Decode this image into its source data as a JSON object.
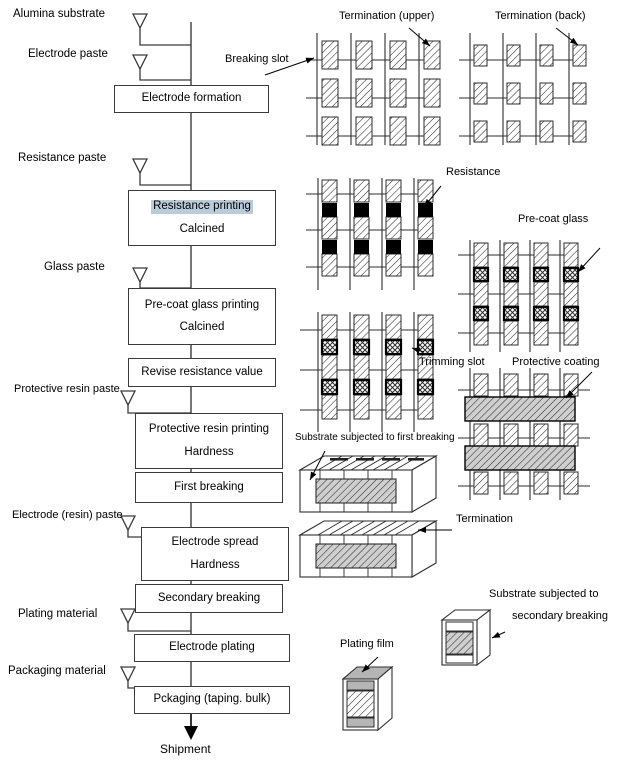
{
  "diagram": {
    "title": "Chip resistor manufacturing process flow",
    "colors": {
      "line": "#3a3a3a",
      "slot": "#6f6f6f",
      "highlight": "#b9ccd9",
      "resistance_fill": "#000000",
      "coating_fill": "#c9c9c9",
      "plating_fill": "#b5b5b5",
      "text": "#000000"
    }
  },
  "flow": {
    "inputs": [
      {
        "label": "Alumina substrate",
        "marker": "inverted-triangle-icon"
      },
      {
        "label": "Electrode paste",
        "marker": "inverted-triangle-icon"
      },
      {
        "label": "Resistance paste",
        "marker": "inverted-triangle-icon"
      },
      {
        "label": "Glass paste",
        "marker": "inverted-triangle-icon"
      },
      {
        "label": "Protective resin paste",
        "marker": "inverted-triangle-icon"
      },
      {
        "label": "Electrode (resin) paste",
        "marker": "inverted-triangle-icon"
      },
      {
        "label": "Plating material",
        "marker": "inverted-triangle-icon"
      },
      {
        "label": "Packaging material",
        "marker": "inverted-triangle-icon"
      }
    ],
    "steps": [
      {
        "line1": "Electrode formation",
        "line2": "",
        "highlight": false
      },
      {
        "line1": "Resistance printing",
        "line2": "Calcined",
        "highlight": true
      },
      {
        "line1": "Pre-coat glass printing",
        "line2": "Calcined",
        "highlight": false
      },
      {
        "line1": "Revise resistance value",
        "line2": "",
        "highlight": false
      },
      {
        "line1": "Protective resin printing",
        "line2": "Hardness",
        "highlight": false
      },
      {
        "line1": "First breaking",
        "line2": "",
        "highlight": false
      },
      {
        "line1": "Electrode spread",
        "line2": "Hardness",
        "highlight": false
      },
      {
        "line1": "Secondary breaking",
        "line2": "",
        "highlight": false
      },
      {
        "line1": "Electrode plating",
        "line2": "",
        "highlight": false
      },
      {
        "line1": "Pckaging (taping. bulk)",
        "line2": "",
        "highlight": false
      }
    ],
    "output": "Shipment"
  },
  "illustrations": {
    "callouts": [
      {
        "id": "breaking-slot",
        "text": "Breaking slot"
      },
      {
        "id": "termination-upper",
        "text": "Termination (upper)"
      },
      {
        "id": "termination-back",
        "text": "Termination (back)"
      },
      {
        "id": "resistance",
        "text": "Resistance"
      },
      {
        "id": "pre-coat-glass",
        "text": "Pre-coat glass"
      },
      {
        "id": "trimming-slot",
        "text": "Trimming slot"
      },
      {
        "id": "protective-coating",
        "text": "Protective coating"
      },
      {
        "id": "substrate-first-breaking",
        "text": "Substrate subjected to first breaking"
      },
      {
        "id": "termination",
        "text": "Termination"
      },
      {
        "id": "substrate-secondary-breaking-line1",
        "text": "Substrate subjected to"
      },
      {
        "id": "substrate-secondary-breaking-line2",
        "text": "secondary breaking"
      },
      {
        "id": "plating-film",
        "text": "Plating film"
      }
    ]
  }
}
